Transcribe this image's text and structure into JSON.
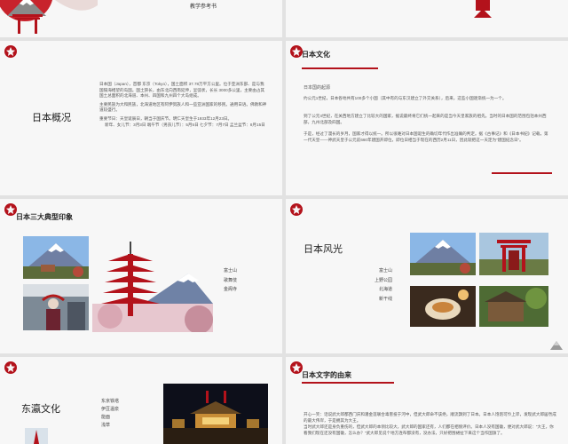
{
  "slides": {
    "s0": {
      "subtitle": "教学参考书"
    },
    "s2": {
      "title": "日本概况",
      "bullets": [
        "日本国（Japan），首都 东京（Tokyo），国土面积 37.78万平方公里。位于亚洲东部、是与我国隔海相望的岛国。国土狭长，由东北向西南延伸，呈弧状，长长 3000多公里，主要由占其国土总面积的北海道、本州、四国和九州四个大岛组成。",
        "主要民族为大和民族，北海道地区有阿伊努族人和一些亚洲国家的移民。通用日语。佛教和神道较盛行。",
        "重要节日：天皇诞辰日，朝当于国庆节。明仁天皇生于1933年12月23日。",
        "新年、女儿节：3月3日 端午节（男孩儿节）：5月5日 七夕节：7月7日 盂兰盆节：8月15日"
      ]
    },
    "s3": {
      "title": "日本文化",
      "heading": "日本国的起源",
      "paragraphs": [
        "约公元1世纪，日本各地共有100多个小国（其中有的与东汉建立了外交关系），后来，这些小国逐渐统一为一个。",
        "到了公元4世纪，在关西地方建立了比较大的国家，据说最终将它们统一起来的是当今天皇家族的祖先。当时的日本国的范围包括本州西部，九州北部及四国。",
        "于是，经过了漫长的岁月，国家才得以统一。所以很难对日本国诞生的确切年代作出准确的判定。据《古事记》和《日本书纪》记载，第一代天皇——神武天皇于公元前660年建国开即位，即位日相当于现在的西历2月11日，因此就把这一天定为“建国纪念日”。"
      ]
    },
    "s4": {
      "title": "日本三大典型印象",
      "labels": [
        "富士山",
        "歌舞伎",
        "金阁寺"
      ]
    },
    "s5": {
      "title": "日本风光",
      "labels": [
        "富士山",
        "上野公园",
        "北海道",
        "新干线"
      ]
    },
    "s6": {
      "title": "东瀛文化",
      "labels": [
        "东京铁塔",
        "伊豆温泉",
        "能面",
        "浅草"
      ]
    },
    "s7": {
      "title": "日本文字的由来",
      "paragraphs": [
        "开心一笑：话说武大郎都西门庆和潘金莲联合毒害投于河中，但武大郎命不该绝，顺流飘到了日本。日本人饱饱可怜上岸，发现武大郎居然成的最大伟岸，于是拥其为大王。",
        "当时武大郎还是身负重伤的，但武大郎的本领比较大，武大郎的国家还有，人们都在相貌评价。日本人没有国徽，便对武大郎说：“大王，你看我们现在还没有国徽，怎么办？”武大郎见说个地方连布都没有，没办法，只好把围裙扯下来这个当作国旗了。"
      ]
    }
  },
  "colors": {
    "accent": "#b3121b",
    "bg": "#f7f7f7",
    "grid_bg": "#e2e2e2"
  }
}
